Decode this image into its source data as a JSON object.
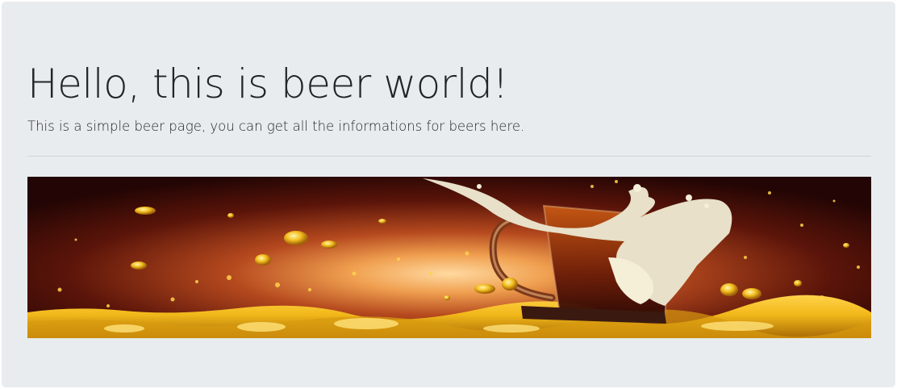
{
  "hero": {
    "title": "Hello, this is beer world!",
    "lead": "This is a simple beer page, you can get all the informations for beers here."
  },
  "banner": {
    "subject": "beer mug splashing foam over golden beer",
    "colors": {
      "background_dark": "#2a0806",
      "glow": "#f0a050",
      "beer": "#f2b81a",
      "foam": "#e8e0c8"
    }
  }
}
